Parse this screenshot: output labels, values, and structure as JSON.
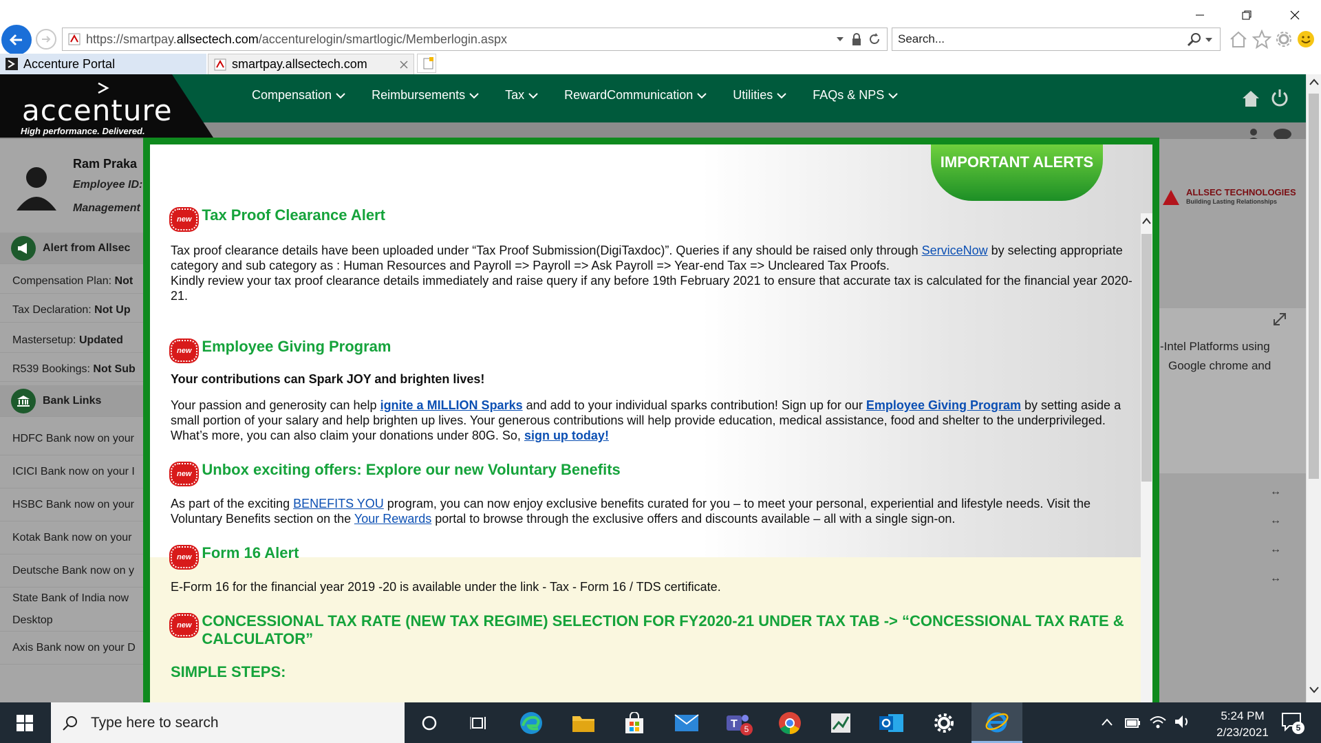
{
  "browser": {
    "url_prefix": "https://smartpay.",
    "url_domain": "allsectech.com",
    "url_path": "/accenturelogin/smartlogic/Memberlogin.aspx",
    "search_placeholder": "Search...",
    "tabs": [
      {
        "label": "Accenture Portal"
      },
      {
        "label": "smartpay.allsectech.com"
      }
    ]
  },
  "portal": {
    "logo": "accenture",
    "logo_tagline": "High performance. Delivered.",
    "nav": [
      "Compensation",
      "Reimbursements",
      "Tax",
      "RewardCommunication",
      "Utilities",
      "FAQs & NPS"
    ],
    "user": {
      "name": "Ram Praka",
      "employee_label": "Employee ID:",
      "management_label": "Management"
    },
    "alert_header": "Alert from Allsec",
    "status_rows": [
      {
        "label": "Compensation Plan:",
        "value": "Not"
      },
      {
        "label": "Tax Declaration:",
        "value": "Not Up"
      },
      {
        "label": "Mastersetup:",
        "value": "Updated"
      },
      {
        "label": "R539 Bookings:",
        "value": "Not Sub"
      }
    ],
    "bank_header": "Bank Links",
    "bank_links": [
      "HDFC Bank now on your",
      "ICICI Bank now on your I",
      "HSBC Bank now on your",
      "Kotak Bank now on your",
      "Deutsche Bank now on y",
      "State Bank of India now",
      "Desktop",
      "Axis Bank now on your D"
    ],
    "allsec_name": "ALLSEC TECHNOLOGIES",
    "allsec_tagline": "Building Lasting Relationships",
    "right_text_1": "-Intel  Platforms  using",
    "right_text_2": "Google  chrome  and"
  },
  "modal": {
    "ribbon": "IMPORTANT ALERTS",
    "new_badge": "new",
    "s1_title": "Tax Proof Clearance Alert",
    "s1_p1a": "Tax proof clearance details have been uploaded under “Tax Proof Submission(DigiTaxdoc)”. Queries if any should be raised only through ",
    "s1_link": "ServiceNow",
    "s1_p1b": " by selecting appropriate category and sub category as : Human Resources and Payroll => Payroll => Ask Payroll => Year-end Tax => Uncleared Tax Proofs.",
    "s1_p2": "Kindly review your tax proof clearance details immediately and raise query if any before 19th February 2021 to ensure that accurate tax is calculated for the financial year 2020-21.",
    "s2_title": "Employee Giving Program",
    "s2_lead": "Your contributions can Spark JOY and brighten lives!",
    "s2_pa": "Your passion and generosity can help ",
    "s2_link1": "ignite a MILLION Sparks",
    "s2_pb": " and add to your individual sparks contribution! Sign up for our ",
    "s2_link2": "Employee Giving Program",
    "s2_pc": " by setting aside a small portion of your salary and help brighten up lives. Your generous contributions will help provide education, medical assistance, food and shelter to the underprivileged. What’s more, you can also claim your donations under 80G. So, ",
    "s2_link3": "sign up today!",
    "s3_title": "Unbox exciting offers: Explore our new Voluntary Benefits",
    "s3_pa": "As part of the exciting ",
    "s3_link1": "BENEFITS YOU",
    "s3_pb": " program, you can now enjoy exclusive benefits curated for you – to meet your personal, experiential and lifestyle needs. Visit the Voluntary Benefits section on the ",
    "s3_link2": "Your Rewards",
    "s3_pc": " portal to browse through the exclusive offers and discounts available – all with a single sign-on.",
    "s4_title": "Form 16 Alert",
    "s4_p": "E-Form 16 for the financial year 2019 -20 is available under the link - Tax - Form 16 / TDS certificate.",
    "s5_title": "CONCESSIONAL TAX RATE (NEW TAX REGIME) SELECTION FOR FY2020-21 UNDER TAX TAB -> “CONCESSIONAL TAX RATE & CALCULATOR”",
    "s6_title": "SIMPLE STEPS:"
  },
  "taskbar": {
    "search_placeholder": "Type here to search",
    "time": "5:24 PM",
    "date": "2/23/2021",
    "teams_badge": "5",
    "notif_count": "5"
  },
  "colors": {
    "header_green": "#005a3c",
    "modal_border": "#0f8a1e",
    "title_green": "#15a33b",
    "link_blue": "#0b4fb3",
    "new_red": "#d81a1a"
  }
}
